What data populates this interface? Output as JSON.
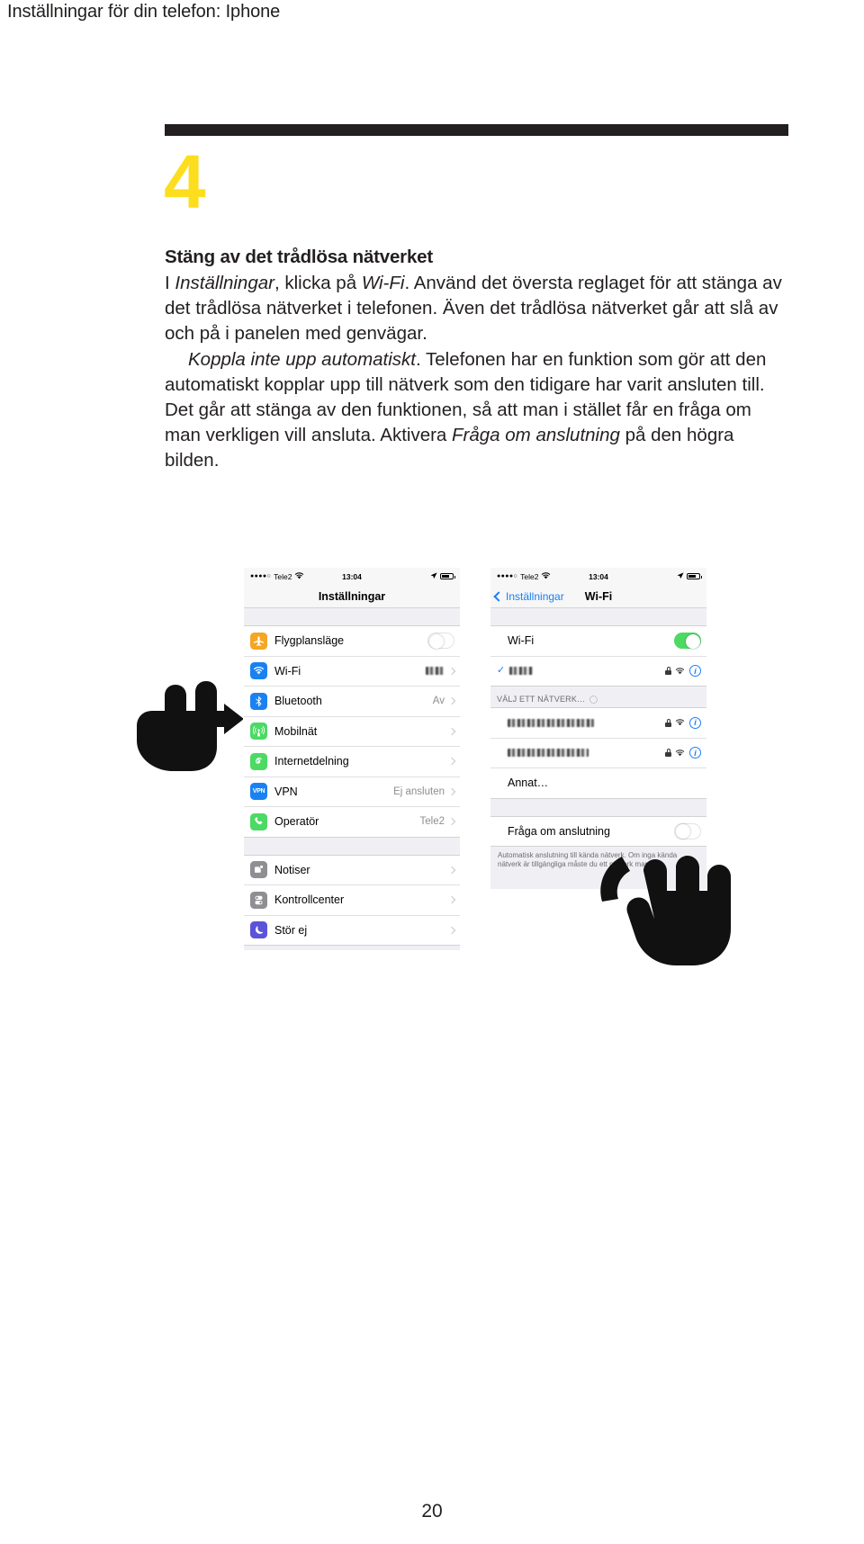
{
  "header": {
    "running_title": "Inställningar för din telefon: Iphone"
  },
  "step": {
    "number": "4",
    "heading": "Stäng av det trådlösa nätverket",
    "paragraph1": {
      "seg1": "I ",
      "em1": "Inställningar",
      "seg2": ", klicka på ",
      "em2": "Wi-Fi",
      "seg3": ". Använd det översta reglaget för att stänga av det trådlösa nätverket i telefonen. Även det trådlösa nätverket går att slå av och på i panelen med genvägar."
    },
    "paragraph2": {
      "em1": "Koppla inte upp automatiskt",
      "seg1": ". Telefonen har en funktion som gör att den automatiskt kopplar upp till nätverk som den tidigare har varit ansluten till. Det går att stänga av den funktionen, så att man i stället får en fråga om man verkligen vill ansluta. Aktivera ",
      "em2": "Fråga om anslutning",
      "seg2": " på den högra bilden."
    }
  },
  "colors": {
    "accent_yellow": "#FCDE1E",
    "rule_black": "#231f20",
    "ios_blue": "#1a7ef4",
    "ios_green": "#4cd964",
    "list_bg": "#efeff4"
  },
  "phone_left": {
    "statusbar": {
      "signal_dots": "●●●●○",
      "carrier": "Tele2",
      "time": "13:04"
    },
    "nav_title": "Inställningar",
    "groups": [
      {
        "rows": [
          {
            "label": "Flygplansläge",
            "icon": "airplane-icon",
            "icon_color": "#f5a623",
            "accessory": "toggle-off"
          },
          {
            "label": "Wi-Fi",
            "icon": "wifi-icon",
            "icon_color": "#1a82f0",
            "accessory": "blurred-value-chevron"
          },
          {
            "label": "Bluetooth",
            "icon": "bluetooth-icon",
            "icon_color": "#1a82f0",
            "value": "Av",
            "accessory": "chevron"
          },
          {
            "label": "Mobilnät",
            "icon": "cellular-icon",
            "icon_color": "#4cd964",
            "accessory": "chevron"
          },
          {
            "label": "Internetdelning",
            "icon": "hotspot-icon",
            "icon_color": "#4cd964",
            "accessory": "chevron"
          },
          {
            "label": "VPN",
            "icon": "vpn-icon",
            "icon_color": "#1a82f0",
            "icon_text": "VPN",
            "value": "Ej ansluten",
            "accessory": "chevron"
          },
          {
            "label": "Operatör",
            "icon": "phone-icon",
            "icon_color": "#4cd964",
            "value": "Tele2",
            "accessory": "chevron"
          }
        ]
      },
      {
        "rows": [
          {
            "label": "Notiser",
            "icon": "notifications-icon",
            "icon_color": "#8e8e93",
            "accessory": "chevron"
          },
          {
            "label": "Kontrollcenter",
            "icon": "control-center-icon",
            "icon_color": "#8e8e93",
            "accessory": "chevron"
          },
          {
            "label": "Stör ej",
            "icon": "moon-icon",
            "icon_color": "#5a54d8",
            "accessory": "chevron"
          }
        ]
      }
    ]
  },
  "phone_right": {
    "statusbar": {
      "signal_dots": "●●●●○",
      "carrier": "Tele2",
      "time": "13:04"
    },
    "back_label": "Inställningar",
    "nav_title": "Wi-Fi",
    "wifi_row": {
      "label": "Wi-Fi",
      "accessory": "toggle-on"
    },
    "connected_network": {
      "name_blurred": true,
      "checked": true
    },
    "section_header": "VÄLJ ETT NÄTVERK…",
    "networks": [
      {
        "name_blurred": true,
        "locked": true
      },
      {
        "name_blurred": true,
        "locked": true
      }
    ],
    "other_label": "Annat…",
    "ask_row": {
      "label": "Fråga om anslutning",
      "accessory": "toggle-off"
    },
    "footnote": "Automatisk anslutning till kända nätverk. Om inga kända nätverk är tillgängliga måste du ett nätverk manuellt."
  },
  "folio": {
    "page_number": "20"
  }
}
